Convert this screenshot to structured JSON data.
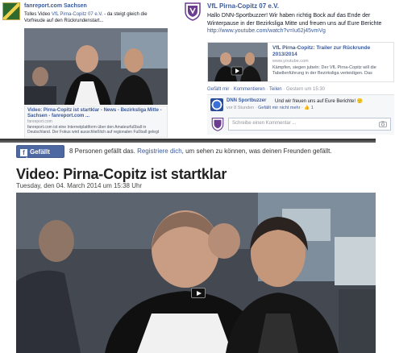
{
  "left_post": {
    "page_name": "fanreport.com Sachsen",
    "text_prefix": "Tolles Video ",
    "text_link": "VfL Pirna-Copitz 07 e.V.",
    "text_suffix": " - da steigt gleich die Vorfreude auf den Rückrundenstart...",
    "link_title": "Video: Pirna-Copitz ist startklar - News - Bezirksliga Mitte - Sachsen - fanreport.com ...",
    "link_domain": "fanreport.com",
    "link_desc": "fanreport.com ist eine Internetplattform über den Amateurfußball in Deutschland. Der Fokus wird ausschließlich auf regionalen Fußball gelegt"
  },
  "right_post": {
    "page_name": "VfL Pirna-Copitz 07 e.V.",
    "text": "Hallo DNN-Sportbuzzer! Wir haben richtig Bock auf das Ende der Winterpause in der Bezirksliga Mitte und freuen uns auf Eure Berichte",
    "url": "http://www.youtube.com/watch?v=Iu62j45vmVg",
    "link_title": "VfL Pirna-Copitz: Trailer zur Rückrunde 2013/2014",
    "link_domain": "www.youtube.com",
    "link_desc": "Kämpfen, siegen jubeln: Der VfL Pirna-Copitz will die Tabellenführung in der Bezirksliga verteidigen. Das",
    "action_like": "Gefällt mir",
    "action_comment": "Kommentieren",
    "action_share": "Teilen",
    "action_time": "Gestern um 15:30",
    "comment_author": "DNN Sportbuzzer",
    "comment_text": "Und wir freuen uns auf Eure Berichte! 🙂",
    "comment_time": "vor 8 Stunden",
    "comment_unlike": "Gefällt mir nicht mehr",
    "comment_likes": "1",
    "comment_placeholder": "Schreibe einen Kommentar ..."
  },
  "article": {
    "like_button": "Gefällt mir",
    "like_count_text": "8 Personen gefällt das.",
    "like_register_link": "Registriere dich",
    "like_suffix": ", um sehen zu können, was deinen Freunden gefällt.",
    "headline": "Video: Pirna-Copitz ist startklar",
    "dateline": "Tuesday, den 04. March 2014 um 15:38 Uhr"
  },
  "colors": {
    "facebook_blue": "#3b5998",
    "like_button": "#4e69a2",
    "club_purple": "#6a3d8f"
  }
}
